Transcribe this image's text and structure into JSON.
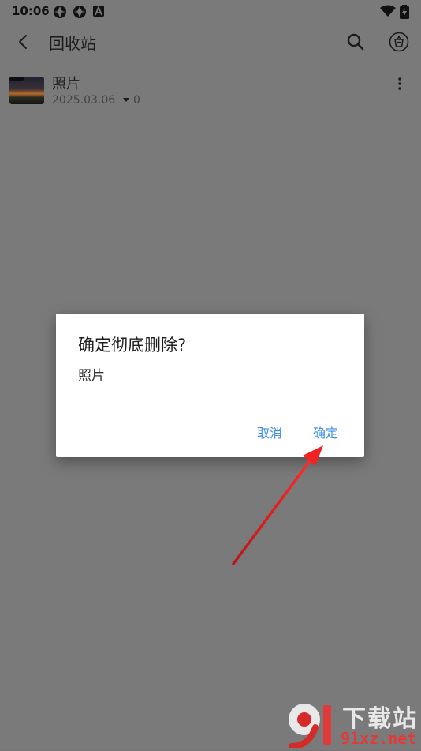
{
  "status_bar": {
    "time": "10:06",
    "icons": [
      "pinwheel-icon",
      "pinwheel-icon",
      "a-square-icon",
      "wifi-icon",
      "battery-charging-icon"
    ]
  },
  "app_bar": {
    "title": "回收站",
    "icons": [
      "back-arrow-icon",
      "search-icon",
      "recycle-bin-icon"
    ]
  },
  "list": {
    "items": [
      {
        "name": "照片",
        "date": "2025.03.06",
        "count": "0",
        "icons": [
          "folder-thumbnail-icon",
          "sort-caret-icon",
          "more-vert-icon"
        ]
      }
    ]
  },
  "dialog": {
    "title": "确定彻底删除?",
    "message": "照片",
    "cancel_label": "取消",
    "confirm_label": "确定"
  },
  "watermark": {
    "logo_icon": "91-logo-icon",
    "text": "下载站",
    "site": "91xz.net"
  },
  "colors": {
    "overlay_bg": "#7a7a7a",
    "dialog_bg": "#ffffff",
    "accent": "#3d8ee8",
    "annotation_arrow": "#d51f1f"
  }
}
